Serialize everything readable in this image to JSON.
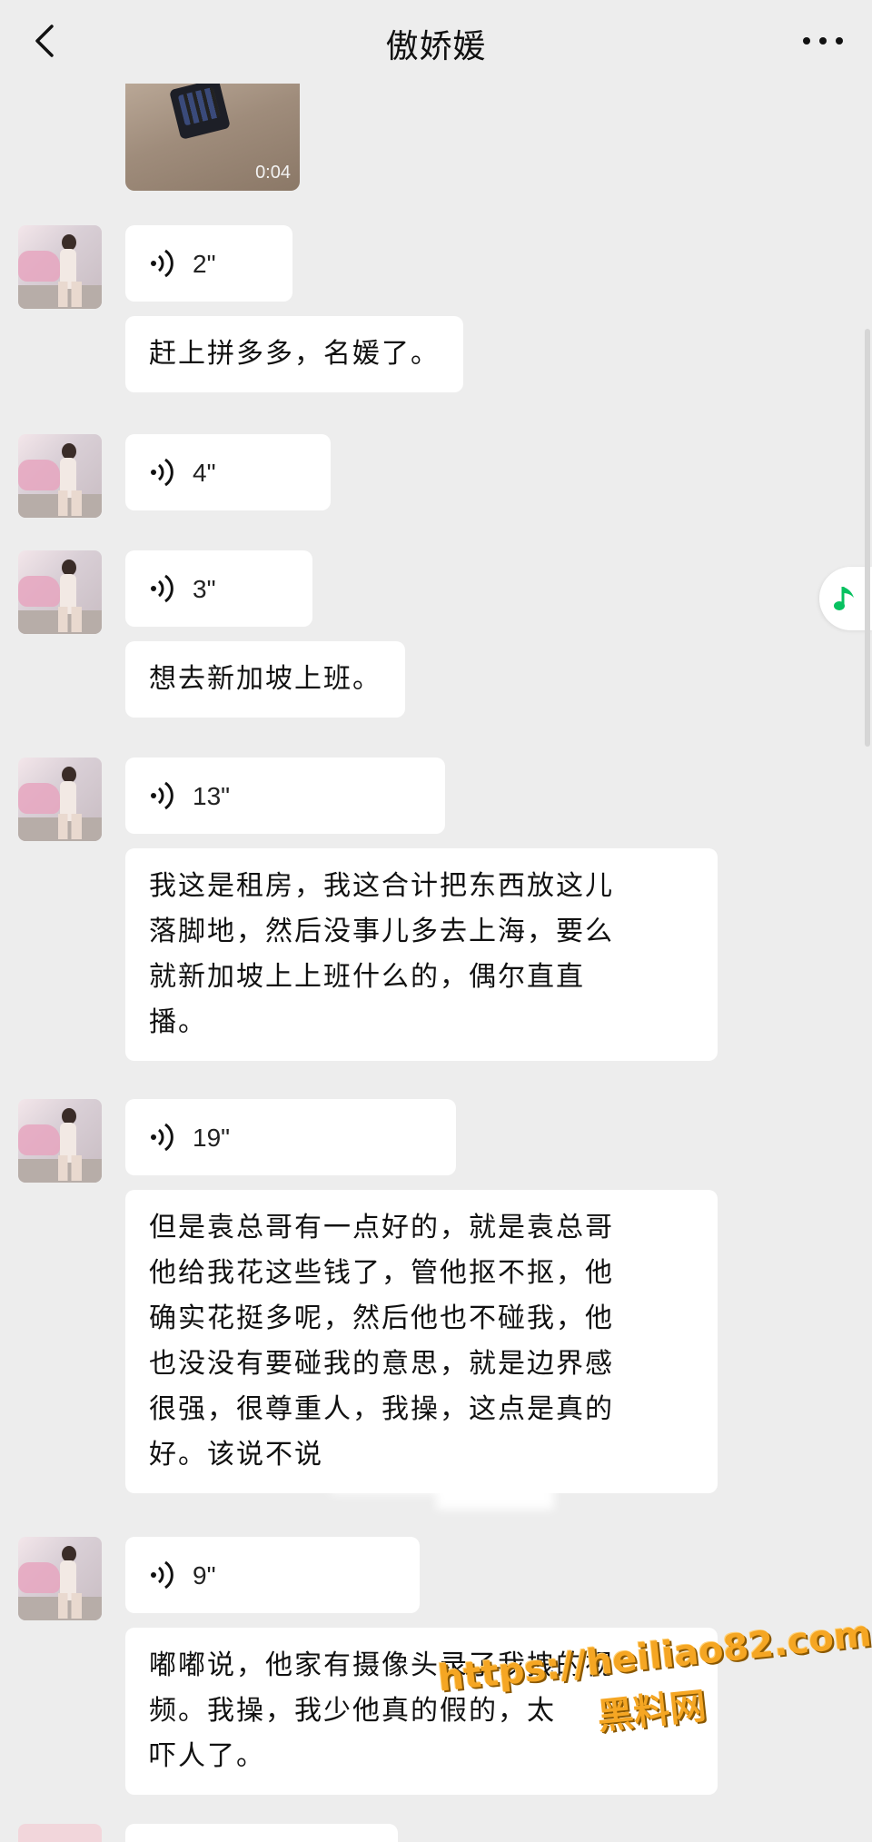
{
  "header": {
    "title": "傲娇媛"
  },
  "video": {
    "duration": "0:04"
  },
  "messages": [
    {
      "type": "voice",
      "duration": "2\""
    },
    {
      "type": "text",
      "text": "赶上拼多多，名媛了。"
    },
    {
      "type": "voice",
      "duration": "4\""
    },
    {
      "type": "voice",
      "duration": "3\""
    },
    {
      "type": "text",
      "text": "想去新加坡上班。"
    },
    {
      "type": "voice",
      "duration": "13\""
    },
    {
      "type": "text",
      "lines": [
        "我这是租房，我这合计把东西放这儿",
        "落脚地，然后没事儿多去上海，要么",
        "就新加坡上上班什么的，偶尔直直",
        "播。"
      ]
    },
    {
      "type": "voice",
      "duration": "19\""
    },
    {
      "type": "text",
      "lines": [
        "但是袁总哥有一点好的，就是袁总哥",
        "他给我花这些钱了，管他抠不抠，他",
        "确实花挺多呢，然后他也不碰我，他",
        "也没没有要碰我的意思，就是边界感",
        "很强，很尊重人，我操，这点是真的",
        "好。该说不说"
      ]
    },
    {
      "type": "voice",
      "duration": "9\""
    },
    {
      "type": "text",
      "lines": [
        "嘟嘟说，他家有摄像头录了我拽的视",
        "频。我操，我少他真的假的，太",
        "吓人了。"
      ]
    }
  ],
  "watermark": {
    "url": "https://heiliao82.com",
    "name": "黑料网"
  },
  "colors": {
    "background": "#ededed",
    "bubble": "#ffffff",
    "accent": "#07c160",
    "watermark": "#f5a623"
  },
  "icons": {
    "back": "chevron-left-icon",
    "more": "ellipsis-icon",
    "voice": "voice-wave-icon",
    "music": "music-note-icon"
  }
}
